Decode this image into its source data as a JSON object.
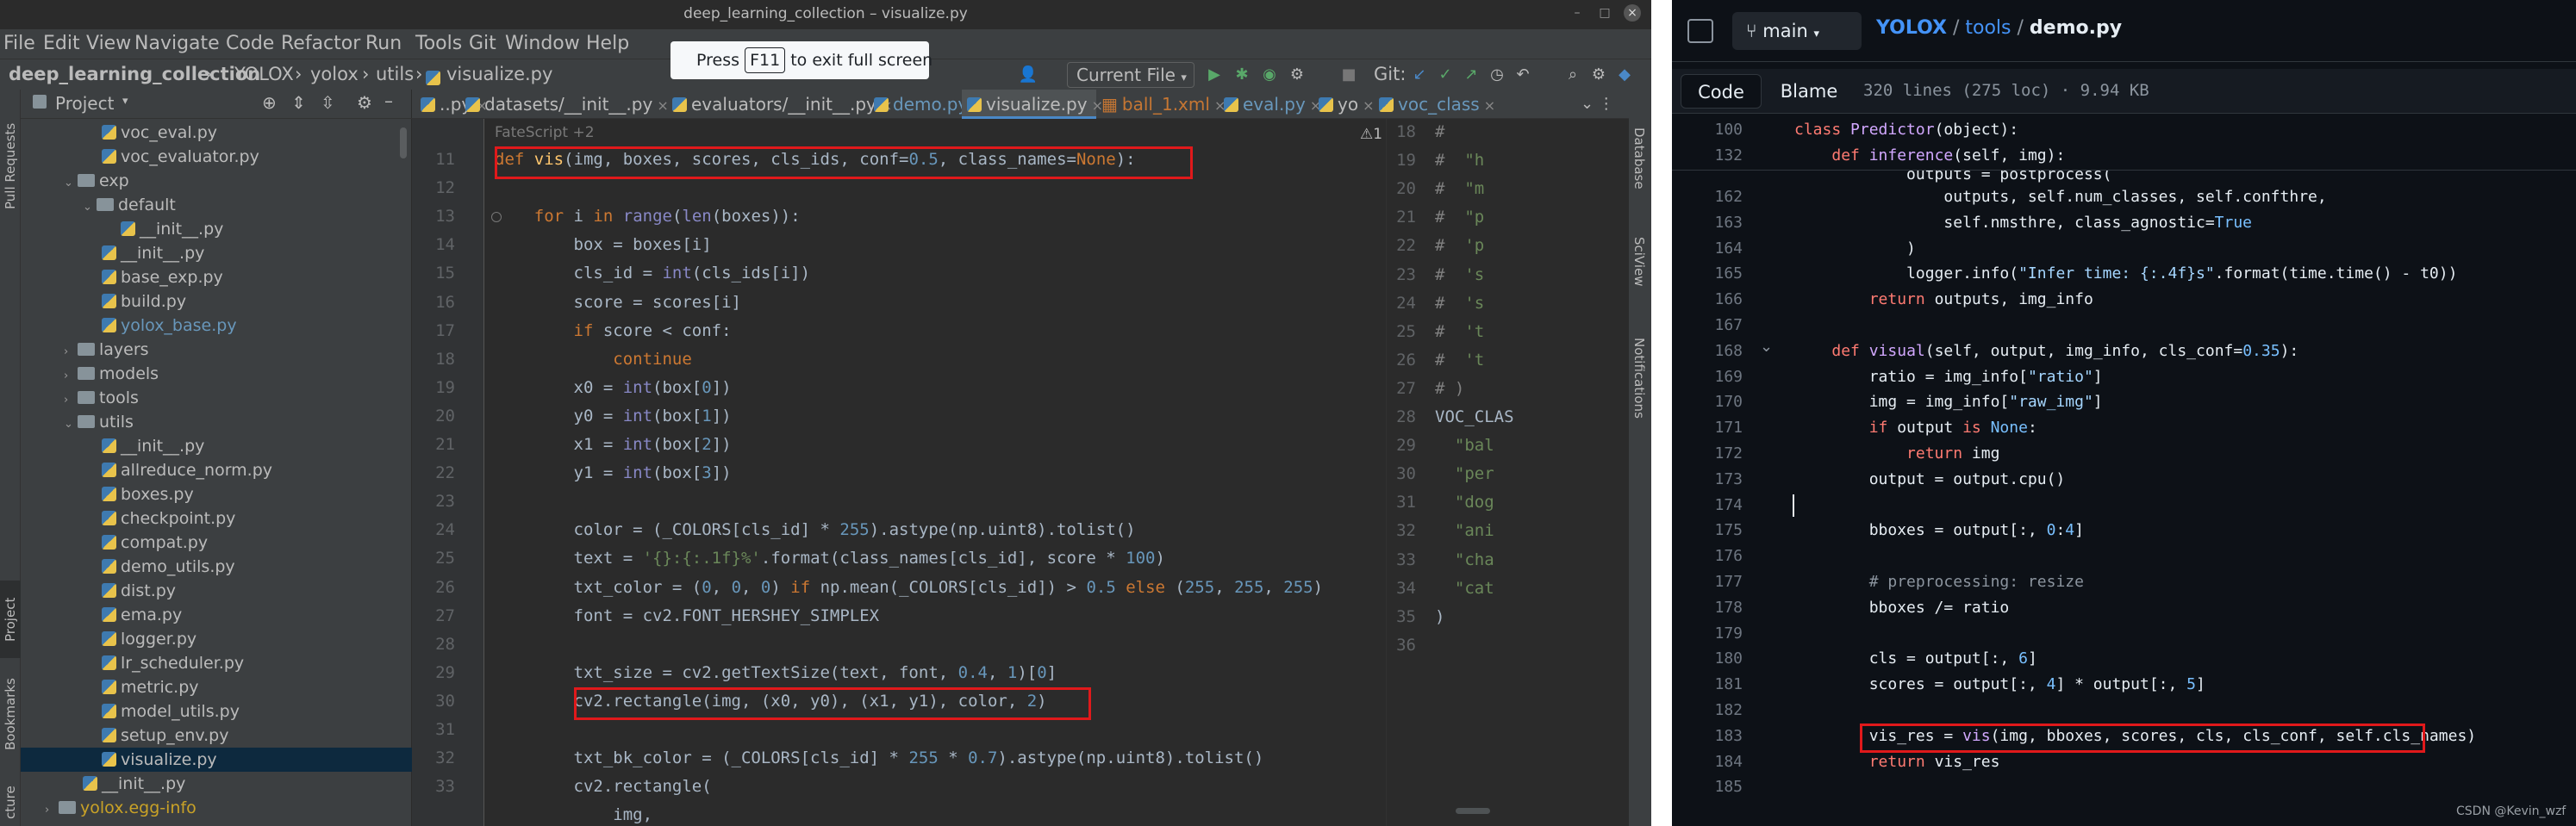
{
  "ide": {
    "window_title": "deep_learning_collection – visualize.py",
    "window_buttons": [
      "–",
      "□",
      "×"
    ],
    "menu": [
      "File",
      "Edit",
      "View",
      "Navigate",
      "Code",
      "Refactor",
      "Run",
      "Tools",
      "Git",
      "Window",
      "Help"
    ],
    "breadcrumb": [
      "deep_learning_collection",
      "YOLOX",
      "yolox",
      "utils",
      "visualize.py"
    ],
    "run_config": "Current File",
    "git_label": "Git:",
    "left_strip": {
      "top": "Pull Requests",
      "project": "Project",
      "bookmarks": "Bookmarks",
      "structure": "cture"
    },
    "right_strip": {
      "database": "Database",
      "sciview": "SciView",
      "notifications": "Notifications"
    },
    "project": {
      "header": "Project",
      "tree": [
        {
          "label": "voc_eval.py",
          "type": "py",
          "indent": 4
        },
        {
          "label": "voc_evaluator.py",
          "type": "py",
          "indent": 4
        },
        {
          "label": "exp",
          "type": "folder",
          "indent": 2,
          "open": true
        },
        {
          "label": "default",
          "type": "folder",
          "indent": 3,
          "open": true
        },
        {
          "label": "__init__.py",
          "type": "py",
          "indent": 5
        },
        {
          "label": "__init__.py",
          "type": "py",
          "indent": 4
        },
        {
          "label": "base_exp.py",
          "type": "py",
          "indent": 4
        },
        {
          "label": "build.py",
          "type": "py",
          "indent": 4
        },
        {
          "label": "yolox_base.py",
          "type": "py",
          "indent": 4,
          "color": "#6897bb"
        },
        {
          "label": "layers",
          "type": "folder",
          "indent": 2,
          "open": false
        },
        {
          "label": "models",
          "type": "folder",
          "indent": 2,
          "open": false
        },
        {
          "label": "tools",
          "type": "folder",
          "indent": 2,
          "open": false
        },
        {
          "label": "utils",
          "type": "folder",
          "indent": 2,
          "open": true
        },
        {
          "label": "__init__.py",
          "type": "py",
          "indent": 4
        },
        {
          "label": "allreduce_norm.py",
          "type": "py",
          "indent": 4
        },
        {
          "label": "boxes.py",
          "type": "py",
          "indent": 4
        },
        {
          "label": "checkpoint.py",
          "type": "py",
          "indent": 4
        },
        {
          "label": "compat.py",
          "type": "py",
          "indent": 4
        },
        {
          "label": "demo_utils.py",
          "type": "py",
          "indent": 4
        },
        {
          "label": "dist.py",
          "type": "py",
          "indent": 4
        },
        {
          "label": "ema.py",
          "type": "py",
          "indent": 4
        },
        {
          "label": "logger.py",
          "type": "py",
          "indent": 4
        },
        {
          "label": "lr_scheduler.py",
          "type": "py",
          "indent": 4
        },
        {
          "label": "metric.py",
          "type": "py",
          "indent": 4
        },
        {
          "label": "model_utils.py",
          "type": "py",
          "indent": 4
        },
        {
          "label": "setup_env.py",
          "type": "py",
          "indent": 4
        },
        {
          "label": "visualize.py",
          "type": "py",
          "indent": 4,
          "selected": true
        },
        {
          "label": "__init__.py",
          "type": "py",
          "indent": 3
        },
        {
          "label": "yolox.egg-info",
          "type": "folder",
          "indent": 1,
          "open": false,
          "color": "#c9a227"
        }
      ]
    },
    "tabs": [
      {
        "label": "..py",
        "color": "#bbbbbb"
      },
      {
        "label": "datasets/__init__.py",
        "color": "#bbbbbb"
      },
      {
        "label": "evaluators/__init__.py",
        "color": "#bbbbbb"
      },
      {
        "label": "demo.py",
        "color": "#6897bb"
      },
      {
        "label": "visualize.py",
        "color": "#bbbbbb",
        "active": true
      },
      {
        "label": "ball_1.xml",
        "color": "#c57633"
      },
      {
        "label": "eval.py",
        "color": "#6897bb"
      },
      {
        "label": "yo",
        "color": "#bbbbbb"
      },
      {
        "label": "voc_class",
        "color": "#6897bb"
      }
    ],
    "inspections": "⚠1  ✔1  ˄  ˅",
    "fatescript": "FateScript +2",
    "line_numbers": [
      "11",
      "12",
      "13",
      "14",
      "15",
      "16",
      "17",
      "18",
      "19",
      "20",
      "21",
      "22",
      "23",
      "24",
      "25",
      "26",
      "27",
      "28",
      "29",
      "30",
      "31",
      "32",
      "33"
    ],
    "code_lines": [
      [
        [
          "kw",
          "def "
        ],
        [
          "fn",
          "vis"
        ],
        [
          "",
          "(img, boxes, scores, cls_ids, conf="
        ],
        [
          "num",
          "0.5"
        ],
        [
          "",
          ", class_names="
        ],
        [
          "kw",
          "None"
        ],
        [
          "",
          "):"
        ]
      ],
      [],
      [
        [
          "",
          "    "
        ],
        [
          "kw",
          "for "
        ],
        [
          "",
          "i "
        ],
        [
          "kw",
          "in "
        ],
        [
          "bi",
          "range"
        ],
        [
          "",
          "("
        ],
        [
          "bi",
          "len"
        ],
        [
          "",
          "(boxes)):"
        ]
      ],
      [
        [
          "",
          "        box = boxes[i]"
        ]
      ],
      [
        [
          "",
          "        cls_id = "
        ],
        [
          "bi",
          "int"
        ],
        [
          "",
          "(cls_ids[i])"
        ]
      ],
      [
        [
          "",
          "        score = scores[i]"
        ]
      ],
      [
        [
          "",
          "        "
        ],
        [
          "kw",
          "if "
        ],
        [
          "",
          "score < conf:"
        ]
      ],
      [
        [
          "",
          "            "
        ],
        [
          "kw",
          "continue"
        ]
      ],
      [
        [
          "",
          "        x0 = "
        ],
        [
          "bi",
          "int"
        ],
        [
          "",
          "(box["
        ],
        [
          "num",
          "0"
        ],
        [
          "",
          "])"
        ]
      ],
      [
        [
          "",
          "        y0 = "
        ],
        [
          "bi",
          "int"
        ],
        [
          "",
          "(box["
        ],
        [
          "num",
          "1"
        ],
        [
          "",
          "])"
        ]
      ],
      [
        [
          "",
          "        x1 = "
        ],
        [
          "bi",
          "int"
        ],
        [
          "",
          "(box["
        ],
        [
          "num",
          "2"
        ],
        [
          "",
          "])"
        ]
      ],
      [
        [
          "",
          "        y1 = "
        ],
        [
          "bi",
          "int"
        ],
        [
          "",
          "(box["
        ],
        [
          "num",
          "3"
        ],
        [
          "",
          "])"
        ]
      ],
      [],
      [
        [
          "",
          "        color = (_COLORS[cls_id] * "
        ],
        [
          "num",
          "255"
        ],
        [
          "",
          ").astype(np.uint8).tolist()"
        ]
      ],
      [
        [
          "",
          "        text = "
        ],
        [
          "str",
          "'{}:{:.1f}%'"
        ],
        [
          "",
          ".format(class_names[cls_id], score * "
        ],
        [
          "num",
          "100"
        ],
        [
          "",
          ")"
        ]
      ],
      [
        [
          "",
          "        txt_color = ("
        ],
        [
          "num",
          "0"
        ],
        [
          "",
          ", "
        ],
        [
          "num",
          "0"
        ],
        [
          "",
          ", "
        ],
        [
          "num",
          "0"
        ],
        [
          "",
          ") "
        ],
        [
          "kw",
          "if "
        ],
        [
          "",
          "np.mean(_COLORS[cls_id]) > "
        ],
        [
          "num",
          "0.5 "
        ],
        [
          "kw",
          "else "
        ],
        [
          "",
          "("
        ],
        [
          "num",
          "255"
        ],
        [
          "",
          ", "
        ],
        [
          "num",
          "255"
        ],
        [
          "",
          ", "
        ],
        [
          "num",
          "255"
        ],
        [
          "",
          ")"
        ]
      ],
      [
        [
          "",
          "        font = cv2.FONT_HERSHEY_SIMPLEX"
        ]
      ],
      [],
      [
        [
          "",
          "        txt_size = cv2.getTextSize(text, font, "
        ],
        [
          "num",
          "0.4"
        ],
        [
          "",
          ", "
        ],
        [
          "num",
          "1"
        ],
        [
          "",
          ")["
        ],
        [
          "num",
          "0"
        ],
        [
          "",
          "]"
        ]
      ],
      [
        [
          "",
          "        cv2.rectangle(img, (x0, y0), (x1, y1), color, "
        ],
        [
          "num",
          "2"
        ],
        [
          "",
          ")"
        ]
      ],
      [],
      [
        [
          "",
          "        txt_bk_color = (_COLORS[cls_id] * "
        ],
        [
          "num",
          "255 "
        ],
        [
          "",
          "* "
        ],
        [
          "num",
          "0.7"
        ],
        [
          "",
          ").astype(np.uint8).tolist()"
        ]
      ],
      [
        [
          "",
          "        cv2.rectangle("
        ]
      ],
      [
        [
          "",
          "            img,"
        ]
      ]
    ],
    "split_numbers": [
      "18",
      "19",
      "20",
      "21",
      "22",
      "23",
      "24",
      "25",
      "26",
      "27",
      "28",
      "29",
      "30",
      "31",
      "32",
      "33",
      "34",
      "35",
      "36"
    ],
    "split_lines": [
      [
        [
          "cm",
          "#"
        ]
      ],
      [
        [
          "cm",
          "#"
        ],
        [
          "str",
          "  \"h"
        ]
      ],
      [
        [
          "cm",
          "#"
        ],
        [
          "str",
          "  \"m"
        ]
      ],
      [
        [
          "cm",
          "#"
        ],
        [
          "str",
          "  \"p"
        ]
      ],
      [
        [
          "cm",
          "#"
        ],
        [
          "str",
          "  'p"
        ]
      ],
      [
        [
          "cm",
          "#"
        ],
        [
          "str",
          "  's"
        ]
      ],
      [
        [
          "cm",
          "#"
        ],
        [
          "str",
          "  's"
        ]
      ],
      [
        [
          "cm",
          "#"
        ],
        [
          "str",
          "  't"
        ]
      ],
      [
        [
          "cm",
          "#"
        ],
        [
          "str",
          "  't"
        ]
      ],
      [
        [
          "cm",
          "# )"
        ]
      ],
      [
        [
          "",
          "VOC_CLAS"
        ]
      ],
      [
        [
          "str",
          "  \"bal"
        ]
      ],
      [
        [
          "str",
          "  \"per"
        ]
      ],
      [
        [
          "str",
          "  \"dog"
        ]
      ],
      [
        [
          "str",
          "  \"ani"
        ]
      ],
      [
        [
          "str",
          "  \"cha"
        ]
      ],
      [
        [
          "str",
          "  \"cat"
        ]
      ],
      [
        [
          "",
          ")"
        ]
      ],
      []
    ]
  },
  "github": {
    "branch": "main",
    "path": [
      "YOLOX",
      "tools",
      "demo.py"
    ],
    "fullscreen_tip": {
      "press": "Press",
      "key": "F11",
      "rest": "to exit full screen"
    },
    "tabs": [
      "Code",
      "Blame"
    ],
    "meta": "320 lines (275 loc) · 9.94 KB",
    "sticky": [
      {
        "num": "100",
        "tokens": [
          [
            "gk",
            "class "
          ],
          [
            "gf",
            "Predictor"
          ],
          [
            "",
            "(object):"
          ]
        ]
      },
      {
        "num": "132",
        "tokens": [
          [
            "",
            "    "
          ],
          [
            "gk",
            "def "
          ],
          [
            "gf",
            "inference"
          ],
          [
            "",
            "(self, img):"
          ]
        ]
      }
    ],
    "lines": [
      {
        "num": "162",
        "tokens": [
          [
            "",
            "                outputs, self.num_classes, self.confthre,"
          ]
        ]
      },
      {
        "num": "163",
        "tokens": [
          [
            "",
            "                self.nmsthre, class_agnostic="
          ],
          [
            "gn",
            "True"
          ]
        ]
      },
      {
        "num": "164",
        "tokens": [
          [
            "",
            "            )"
          ]
        ]
      },
      {
        "num": "165",
        "tokens": [
          [
            "",
            "            logger.info("
          ],
          [
            "gs",
            "\"Infer time: {:.4f}s\""
          ],
          [
            "",
            ".format(time.time() - t0))"
          ]
        ]
      },
      {
        "num": "166",
        "tokens": [
          [
            "",
            "        "
          ],
          [
            "gk",
            "return "
          ],
          [
            "",
            "outputs, img_info"
          ]
        ]
      },
      {
        "num": "167",
        "tokens": []
      },
      {
        "num": "168",
        "tokens": [
          [
            "",
            "    "
          ],
          [
            "gk",
            "def "
          ],
          [
            "gf",
            "visual"
          ],
          [
            "",
            "(self, output, img_info, cls_conf="
          ],
          [
            "gn",
            "0.35"
          ],
          [
            "",
            "):"
          ]
        ]
      },
      {
        "num": "169",
        "tokens": [
          [
            "",
            "        ratio = img_info["
          ],
          [
            "gs",
            "\"ratio\""
          ],
          [
            "",
            "]"
          ]
        ]
      },
      {
        "num": "170",
        "tokens": [
          [
            "",
            "        img = img_info["
          ],
          [
            "gs",
            "\"raw_img\""
          ],
          [
            "",
            "]"
          ]
        ]
      },
      {
        "num": "171",
        "tokens": [
          [
            "",
            "        "
          ],
          [
            "gk",
            "if "
          ],
          [
            "",
            "output "
          ],
          [
            "gk",
            "is "
          ],
          [
            "gn",
            "None"
          ],
          [
            "",
            ":"
          ]
        ]
      },
      {
        "num": "172",
        "tokens": [
          [
            "",
            "            "
          ],
          [
            "gk",
            "return "
          ],
          [
            "",
            "img"
          ]
        ]
      },
      {
        "num": "173",
        "tokens": [
          [
            "",
            "        output = output.cpu()"
          ]
        ]
      },
      {
        "num": "174",
        "tokens": []
      },
      {
        "num": "175",
        "tokens": [
          [
            "",
            "        bboxes = output[:, "
          ],
          [
            "gn",
            "0"
          ],
          [
            "",
            ":"
          ],
          [
            "gn",
            "4"
          ],
          [
            "",
            "]"
          ]
        ]
      },
      {
        "num": "176",
        "tokens": []
      },
      {
        "num": "177",
        "tokens": [
          [
            "",
            "        "
          ],
          [
            "gc",
            "# preprocessing: resize"
          ]
        ]
      },
      {
        "num": "178",
        "tokens": [
          [
            "",
            "        bboxes /= ratio"
          ]
        ]
      },
      {
        "num": "179",
        "tokens": []
      },
      {
        "num": "180",
        "tokens": [
          [
            "",
            "        cls = output[:, "
          ],
          [
            "gn",
            "6"
          ],
          [
            "",
            "]"
          ]
        ]
      },
      {
        "num": "181",
        "tokens": [
          [
            "",
            "        scores = output[:, "
          ],
          [
            "gn",
            "4"
          ],
          [
            "",
            "] * output[:, "
          ],
          [
            "gn",
            "5"
          ],
          [
            "",
            "]"
          ]
        ]
      },
      {
        "num": "182",
        "tokens": []
      },
      {
        "num": "183",
        "tokens": [
          [
            "",
            "        vis_res = "
          ],
          [
            "gf",
            "vis"
          ],
          [
            "",
            "(img, bboxes, scores, cls, cls_conf, self.cls_names)"
          ]
        ]
      },
      {
        "num": "184",
        "tokens": [
          [
            "",
            "        "
          ],
          [
            "gk",
            "return "
          ],
          [
            "",
            "vis_res"
          ]
        ]
      },
      {
        "num": "185",
        "tokens": []
      }
    ],
    "partial_line": "            outputs = postprocess("
  },
  "watermark": "CSDN @Kevin_wzf"
}
